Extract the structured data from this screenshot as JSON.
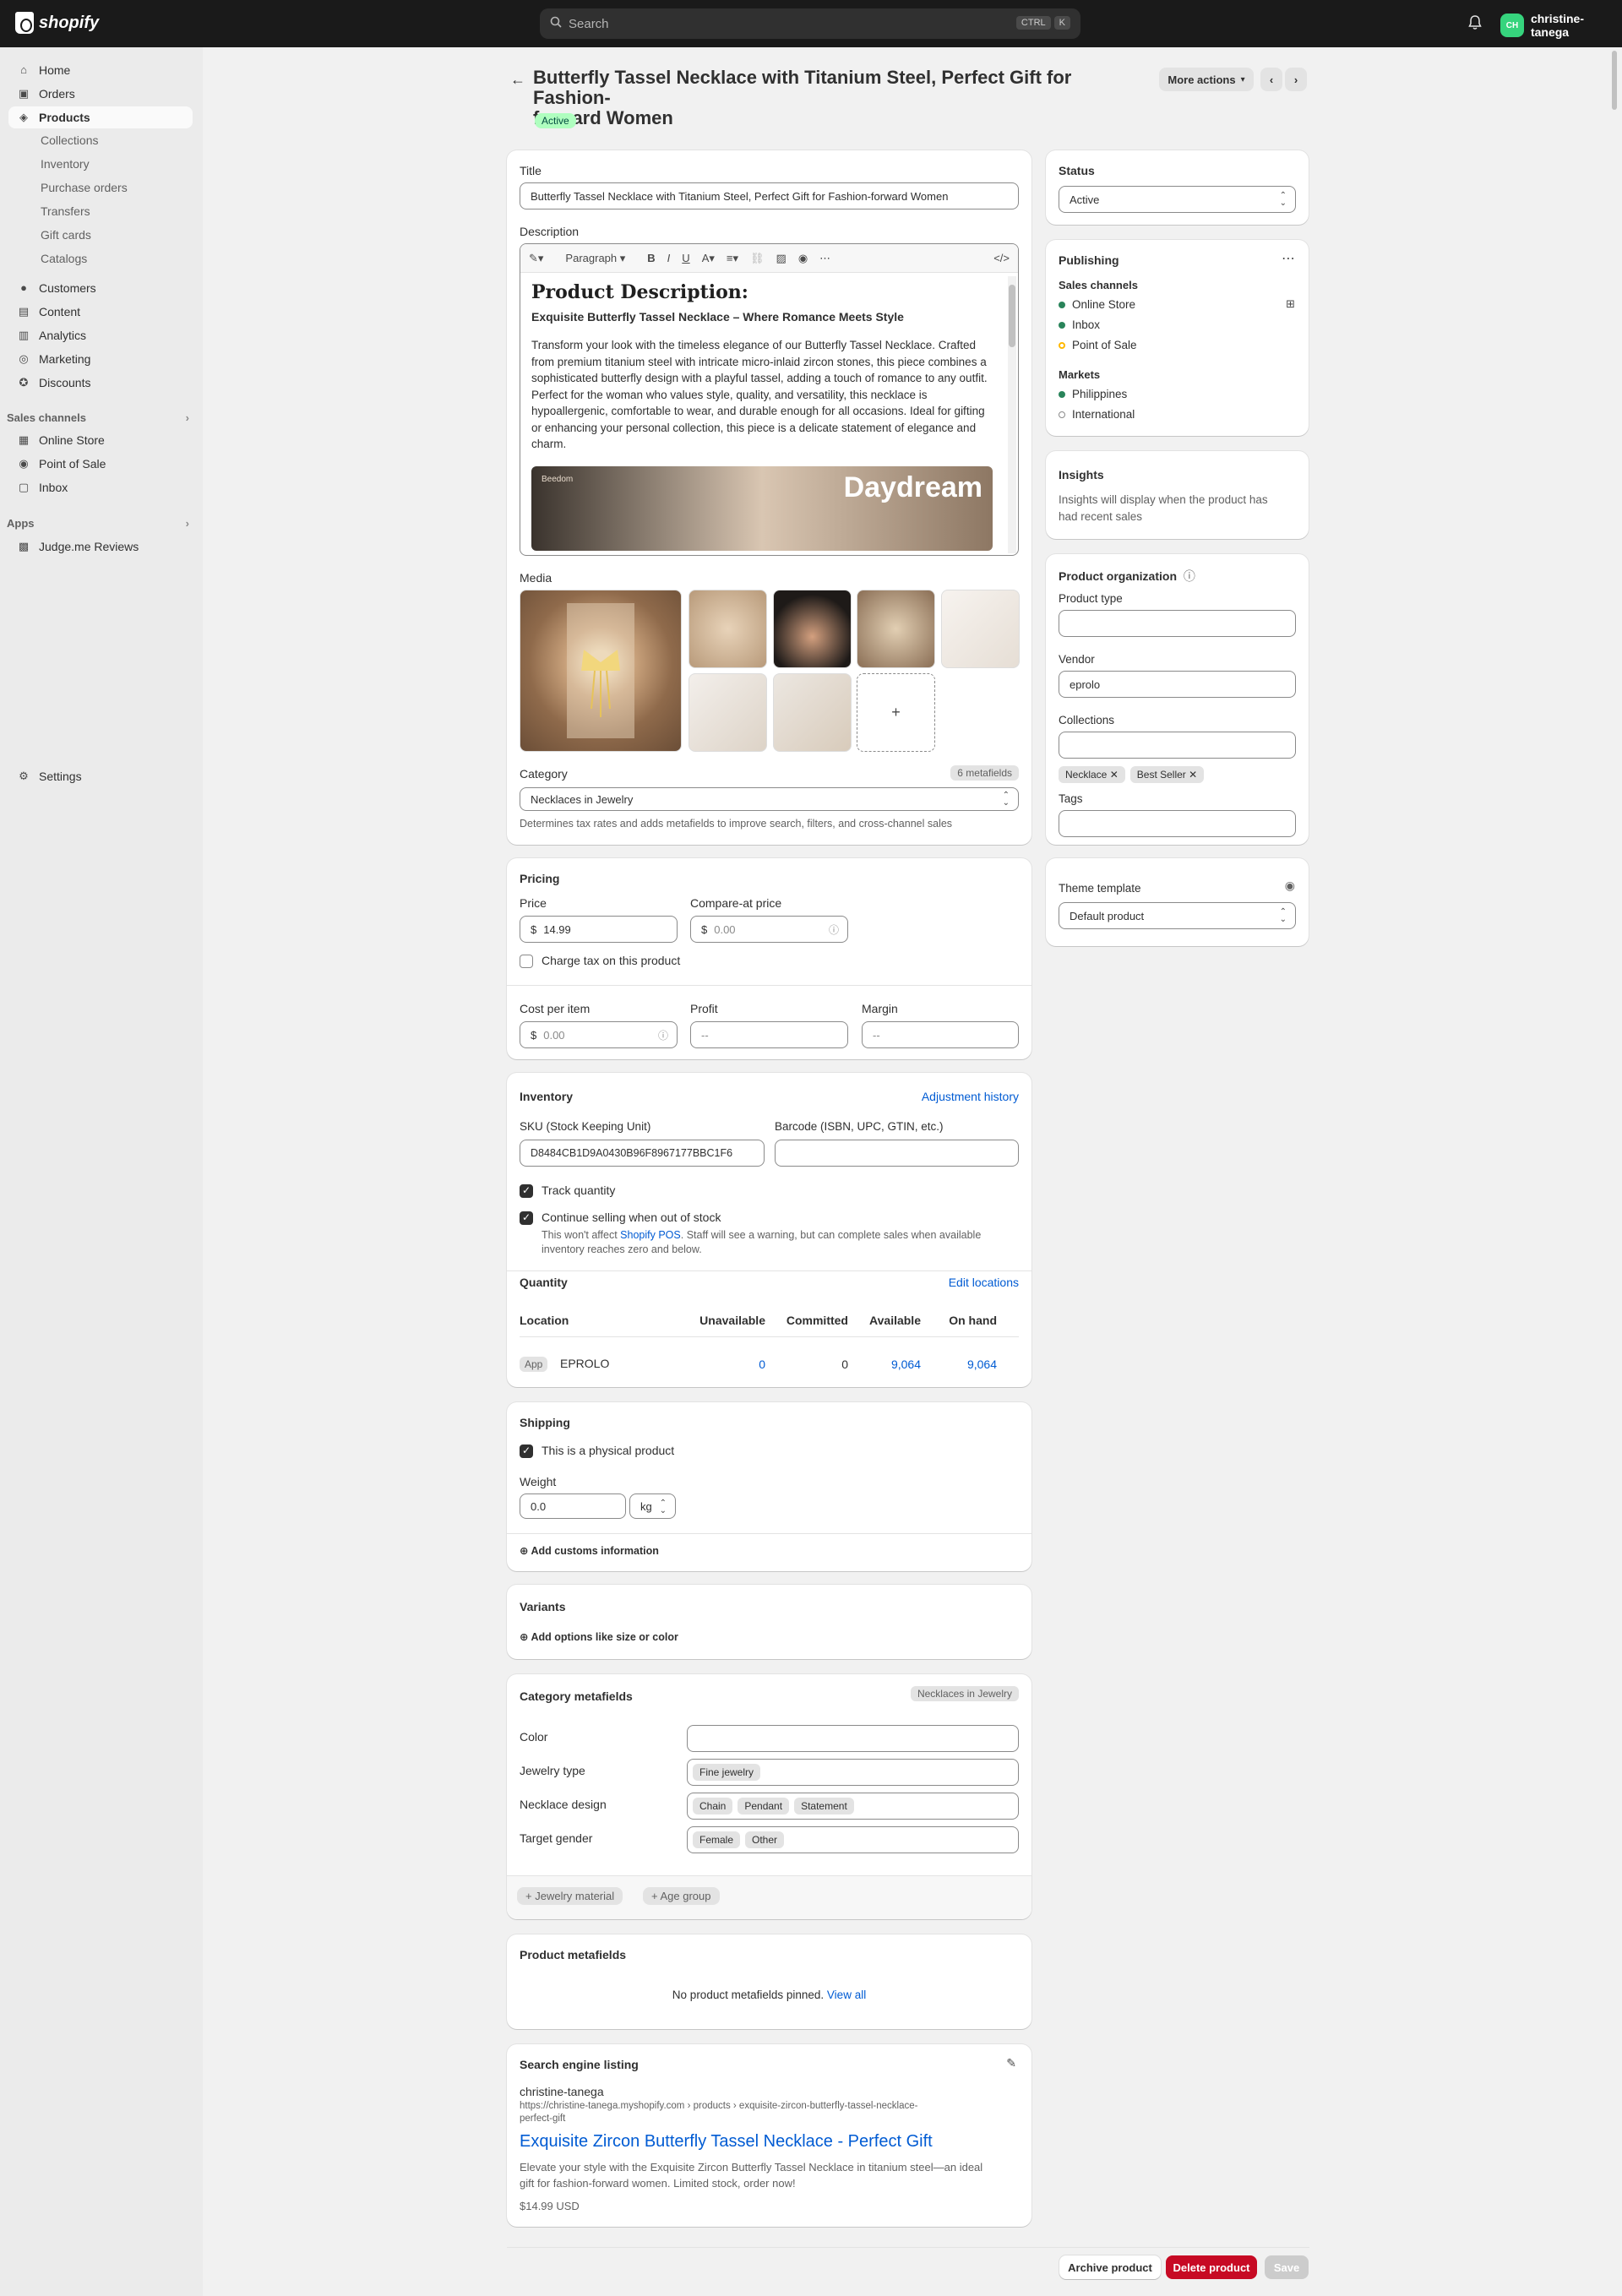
{
  "topbar": {
    "brand": "shopify",
    "search_placeholder": "Search",
    "kbd1": "CTRL",
    "kbd2": "K",
    "user_name": "christine-tanega",
    "avatar_initials": "CH"
  },
  "sidebar": {
    "items": [
      {
        "label": "Home",
        "icon": "home-icon"
      },
      {
        "label": "Orders",
        "icon": "orders-icon"
      },
      {
        "label": "Products",
        "icon": "tag-icon"
      },
      {
        "label": "Customers",
        "icon": "person-icon"
      },
      {
        "label": "Content",
        "icon": "content-icon"
      },
      {
        "label": "Analytics",
        "icon": "chart-icon"
      },
      {
        "label": "Marketing",
        "icon": "target-icon"
      },
      {
        "label": "Discounts",
        "icon": "discount-icon"
      }
    ],
    "product_sub": [
      "Collections",
      "Inventory",
      "Purchase orders",
      "Transfers",
      "Gift cards",
      "Catalogs"
    ],
    "sales_channels_label": "Sales channels",
    "channels": [
      "Online Store",
      "Point of Sale",
      "Inbox"
    ],
    "apps_label": "Apps",
    "apps": [
      "Judge.me Reviews"
    ],
    "settings": "Settings"
  },
  "header": {
    "title_line1": "Butterfly Tassel Necklace with Titanium Steel, Perfect Gift for Fashion-",
    "title_line2": "forward Women",
    "status_badge": "Active",
    "more_actions": "More actions"
  },
  "product": {
    "title_label": "Title",
    "title_value": "Butterfly Tassel Necklace with Titanium Steel, Perfect Gift for Fashion-forward Women",
    "description_label": "Description",
    "toolbar_paragraph": "Paragraph",
    "desc_heading": "Product Description:",
    "desc_subheading": "Exquisite Butterfly Tassel Necklace – Where Romance Meets Style",
    "desc_body": "Transform your look with the timeless elegance of our Butterfly Tassel Necklace. Crafted from premium titanium steel with intricate micro-inlaid zircon stones, this piece combines a sophisticated butterfly design with a playful tassel, adding a touch of romance to any outfit. Perfect for the woman who values style, quality, and versatility, this necklace is hypoallergenic, comfortable to wear, and durable enough for all occasions. Ideal for gifting or enhancing your personal collection, this piece is a delicate statement of elegance and charm.",
    "desc_image_text": "Daydream",
    "desc_image_small": "Beedom",
    "media_label": "Media",
    "category_label": "Category",
    "metafields_count": "6 metafields",
    "category_value": "Necklaces in Jewelry",
    "category_help": "Determines tax rates and adds metafields to improve search, filters, and cross-channel sales"
  },
  "pricing": {
    "heading": "Pricing",
    "price_label": "Price",
    "price_value": "14.99",
    "compare_label": "Compare-at price",
    "compare_placeholder": "0.00",
    "currency": "$",
    "charge_tax": "Charge tax on this product",
    "cost_label": "Cost per item",
    "cost_placeholder": "0.00",
    "profit_label": "Profit",
    "profit_value": "--",
    "margin_label": "Margin",
    "margin_value": "--"
  },
  "inventory": {
    "heading": "Inventory",
    "adjustment_link": "Adjustment history",
    "sku_label": "SKU (Stock Keeping Unit)",
    "sku_value": "D8484CB1D9A0430B96F8967177BBC1F6",
    "barcode_label": "Barcode (ISBN, UPC, GTIN, etc.)",
    "track_label": "Track quantity",
    "continue_label": "Continue selling when out of stock",
    "pos_note_a": "This won't affect ",
    "pos_link": "Shopify POS",
    "pos_note_b": ". Staff will see a warning, but can complete sales when available",
    "pos_note_c": "inventory reaches zero and below.",
    "quantity_label": "Quantity",
    "edit_locations": "Edit locations",
    "columns": [
      "Location",
      "Unavailable",
      "Committed",
      "Available",
      "On hand"
    ],
    "row": {
      "app_badge": "App",
      "location": "EPROLO",
      "unavailable": "0",
      "committed": "0",
      "available": "9,064",
      "on_hand": "9,064"
    }
  },
  "shipping": {
    "heading": "Shipping",
    "physical": "This is a physical product",
    "weight_label": "Weight",
    "weight_value": "0.0",
    "unit": "kg",
    "customs": "Add customs information"
  },
  "variants": {
    "heading": "Variants",
    "add_options": "Add options like size or color"
  },
  "category_metafields": {
    "heading": "Category metafields",
    "badge": "Necklaces in Jewelry",
    "rows": [
      {
        "label": "Color",
        "chips": []
      },
      {
        "label": "Jewelry type",
        "chips": [
          "Fine jewelry"
        ]
      },
      {
        "label": "Necklace design",
        "chips": [
          "Chain",
          "Pendant",
          "Statement"
        ]
      },
      {
        "label": "Target gender",
        "chips": [
          "Female",
          "Other"
        ]
      }
    ],
    "add_buttons": [
      "Jewelry material",
      "Age group"
    ]
  },
  "product_metafields": {
    "heading": "Product metafields",
    "empty_text": "No product metafields pinned.",
    "view_all": "View all"
  },
  "seo": {
    "heading": "Search engine listing",
    "store": "christine-tanega",
    "url_line1": "https://christine-tanega.myshopify.com › products › exquisite-zircon-butterfly-tassel-necklace-",
    "url_line2": "perfect-gift",
    "title": "Exquisite Zircon Butterfly Tassel Necklace - Perfect Gift",
    "desc_line1": "Elevate your style with the Exquisite Zircon Butterfly Tassel Necklace in titanium steel—an ideal",
    "desc_line2": "gift for fashion-forward women. Limited stock, order now!",
    "price": "$14.99 USD"
  },
  "right": {
    "status_label": "Status",
    "status_value": "Active",
    "publishing": "Publishing",
    "sales_channels": "Sales channels",
    "channels": [
      {
        "name": "Online Store",
        "color": "#29845a"
      },
      {
        "name": "Inbox",
        "color": "#29845a"
      },
      {
        "name": "Point of Sale",
        "color": "#ffb800"
      }
    ],
    "markets": "Markets",
    "market_list": [
      {
        "name": "Philippines",
        "color": "#29845a"
      },
      {
        "name": "International",
        "color": "#ffffff"
      }
    ],
    "insights": "Insights",
    "insights_text1": "Insights will display when the product has",
    "insights_text2": "had recent sales",
    "org": "Product organization",
    "type_label": "Product type",
    "vendor_label": "Vendor",
    "vendor_value": "eprolo",
    "collections_label": "Collections",
    "collection_chips": [
      "Necklace",
      "Best Seller"
    ],
    "tags_label": "Tags",
    "theme_label": "Theme template",
    "theme_value": "Default product"
  },
  "footer": {
    "archive": "Archive product",
    "delete": "Delete product",
    "save": "Save"
  }
}
